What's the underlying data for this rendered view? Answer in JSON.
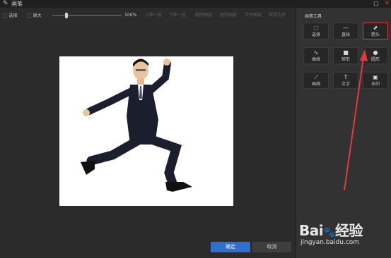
{
  "window": {
    "title": "画笔",
    "max_glyph": "□",
    "close_glyph": "✕"
  },
  "toolbar": {
    "select_label": "选择",
    "original_label": "原大",
    "zoom": "100%",
    "actions": [
      "上移一层",
      "下移一层",
      "删除图层",
      "复制图层",
      "合并图层",
      "取消合并"
    ]
  },
  "panel": {
    "title": "画笔工具",
    "tools": [
      {
        "label": "选择",
        "icon": "select-icon",
        "glyph": "⬚"
      },
      {
        "label": "直线",
        "icon": "line-icon",
        "glyph": "—"
      },
      {
        "label": "箭头",
        "icon": "arrow-icon",
        "glyph": "⬈"
      },
      {
        "label": "曲线",
        "icon": "curve-icon",
        "glyph": "∿"
      },
      {
        "label": "矩形",
        "icon": "rect-icon",
        "glyph": "■"
      },
      {
        "label": "圆形",
        "icon": "circle-icon",
        "glyph": "●"
      },
      {
        "label": "画线",
        "icon": "brush-icon",
        "glyph": "⟋"
      },
      {
        "label": "文字",
        "icon": "text-icon",
        "glyph": "T"
      },
      {
        "label": "水印",
        "icon": "watermark-icon",
        "glyph": "▣"
      }
    ],
    "highlight_color": "#e03a3a"
  },
  "buttons": {
    "ok": "确定",
    "cancel": "取消"
  },
  "watermark": {
    "logo_text": "Bai",
    "logo_mid": "du",
    "logo_cn": "经验",
    "url": "jingyan.baidu.com"
  },
  "colors": {
    "accent": "#2f6fd0",
    "annotation": "#e03a3a"
  }
}
